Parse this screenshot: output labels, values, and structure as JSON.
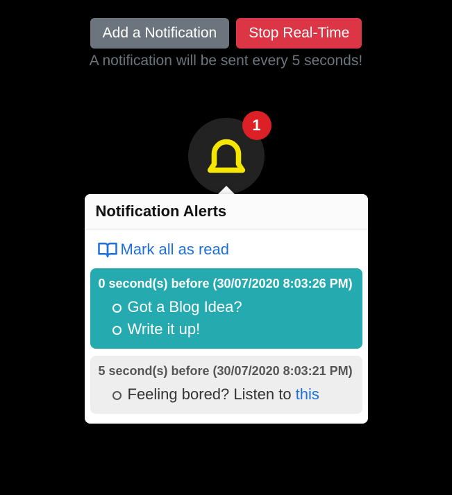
{
  "buttons": {
    "add": "Add a Notification",
    "stop": "Stop Real-Time"
  },
  "info": "A notification will be sent every 5 seconds!",
  "badge_count": "1",
  "panel": {
    "title": "Notification Alerts",
    "mark_all": "Mark all as read"
  },
  "notifications": [
    {
      "time": "0 second(s) before (30/07/2020 8:03:26 PM)",
      "lines": [
        "Got a Blog Idea?",
        "Write it up!"
      ],
      "unread": true
    },
    {
      "time": "5 second(s) before (30/07/2020 8:03:21 PM)",
      "line_prefix": "Feeling bored? Listen to ",
      "line_link": "this",
      "unread": false
    }
  ]
}
